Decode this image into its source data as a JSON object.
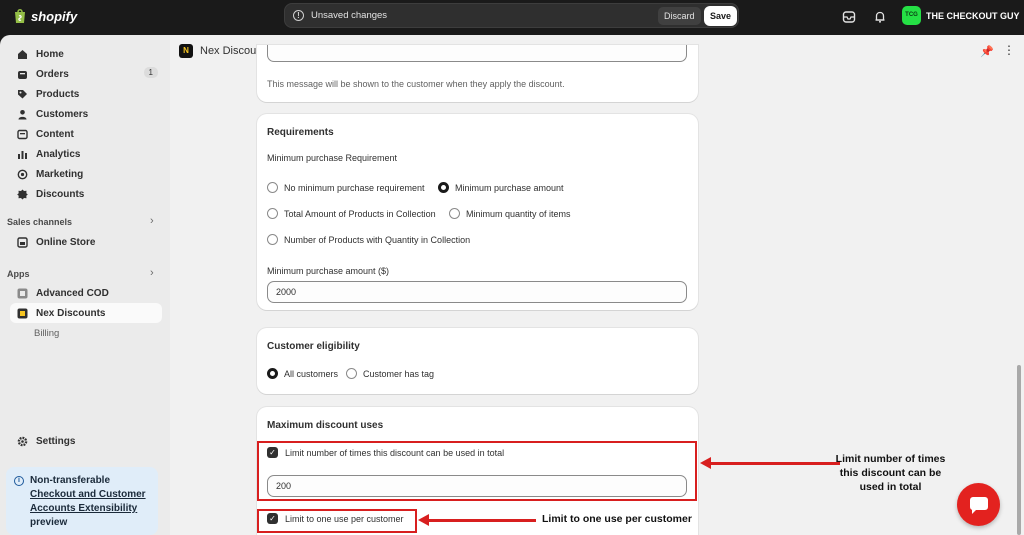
{
  "topbar": {
    "brand": "shopify",
    "unsaved_message": "Unsaved changes",
    "discard_label": "Discard",
    "save_label": "Save",
    "store_initials": "TCG",
    "store_name": "THE CHECKOUT GUY"
  },
  "sidebar": {
    "items": [
      {
        "label": "Home",
        "icon": "home-icon"
      },
      {
        "label": "Orders",
        "icon": "orders-icon",
        "badge": "1"
      },
      {
        "label": "Products",
        "icon": "tag-icon"
      },
      {
        "label": "Customers",
        "icon": "person-icon"
      },
      {
        "label": "Content",
        "icon": "content-icon"
      },
      {
        "label": "Analytics",
        "icon": "analytics-icon"
      },
      {
        "label": "Marketing",
        "icon": "target-icon"
      },
      {
        "label": "Discounts",
        "icon": "discount-icon"
      }
    ],
    "sales_channels_label": "Sales channels",
    "online_store_label": "Online Store",
    "apps_label": "Apps",
    "apps": [
      {
        "label": "Advanced COD"
      },
      {
        "label": "Nex Discounts"
      }
    ],
    "billing_label": "Billing",
    "settings_label": "Settings",
    "notice": {
      "line1": "Non-transferable",
      "link": "Checkout and Customer Accounts Extensibility",
      "line3": "preview"
    }
  },
  "app": {
    "title": "Nex Discounts"
  },
  "message_card": {
    "help": "This message will be shown to the customer when they apply the discount."
  },
  "requirements": {
    "title": "Requirements",
    "subtitle": "Minimum purchase Requirement",
    "options": [
      {
        "label": "No minimum purchase requirement",
        "selected": false
      },
      {
        "label": "Minimum purchase amount",
        "selected": true
      },
      {
        "label": "Total Amount of Products in Collection",
        "selected": false
      },
      {
        "label": "Minimum quantity of items",
        "selected": false
      },
      {
        "label": "Number of Products with Quantity in Collection",
        "selected": false
      }
    ],
    "amount_label": "Minimum purchase amount ($)",
    "amount_value": "2000"
  },
  "eligibility": {
    "title": "Customer eligibility",
    "options": [
      {
        "label": "All customers",
        "selected": true
      },
      {
        "label": "Customer has tag",
        "selected": false
      }
    ]
  },
  "max_uses": {
    "title": "Maximum discount uses",
    "limit_total_label": "Limit number of times this discount can be used in total",
    "limit_total_checked": true,
    "limit_total_value": "200",
    "limit_one_label": "Limit to one use per customer",
    "limit_one_checked": true
  },
  "annotations": {
    "total_line1": "Limit number of times",
    "total_line2": "this discount can be",
    "total_line3": "used in total",
    "per_customer": "Limit to one use per customer",
    "highlight_color": "#d81f1f"
  }
}
